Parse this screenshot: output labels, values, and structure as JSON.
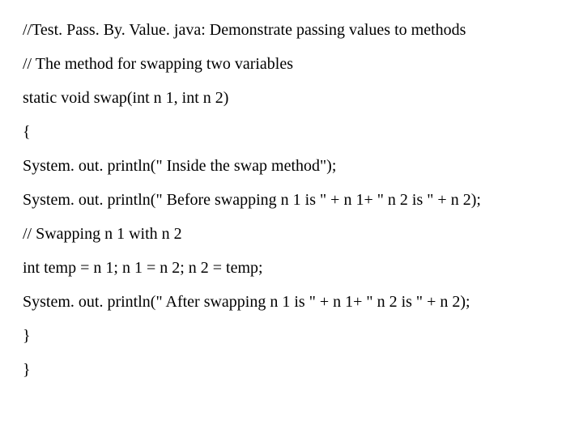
{
  "lines": [
    "//Test. Pass. By. Value. java: Demonstrate passing values to methods",
    "// The method for swapping two variables",
    "static void swap(int n 1, int n 2)",
    "{",
    "System. out. println(\" Inside the swap method\");",
    "System. out. println(\" Before swapping n 1 is \" + n 1+ \" n 2 is \" + n 2);",
    "// Swapping n 1 with n 2",
    "int temp = n 1; n 1 = n 2;  n 2 = temp;",
    "System. out. println(\" After swapping n 1 is \" + n 1+ \" n 2 is \" + n 2);",
    "}",
    "}"
  ]
}
